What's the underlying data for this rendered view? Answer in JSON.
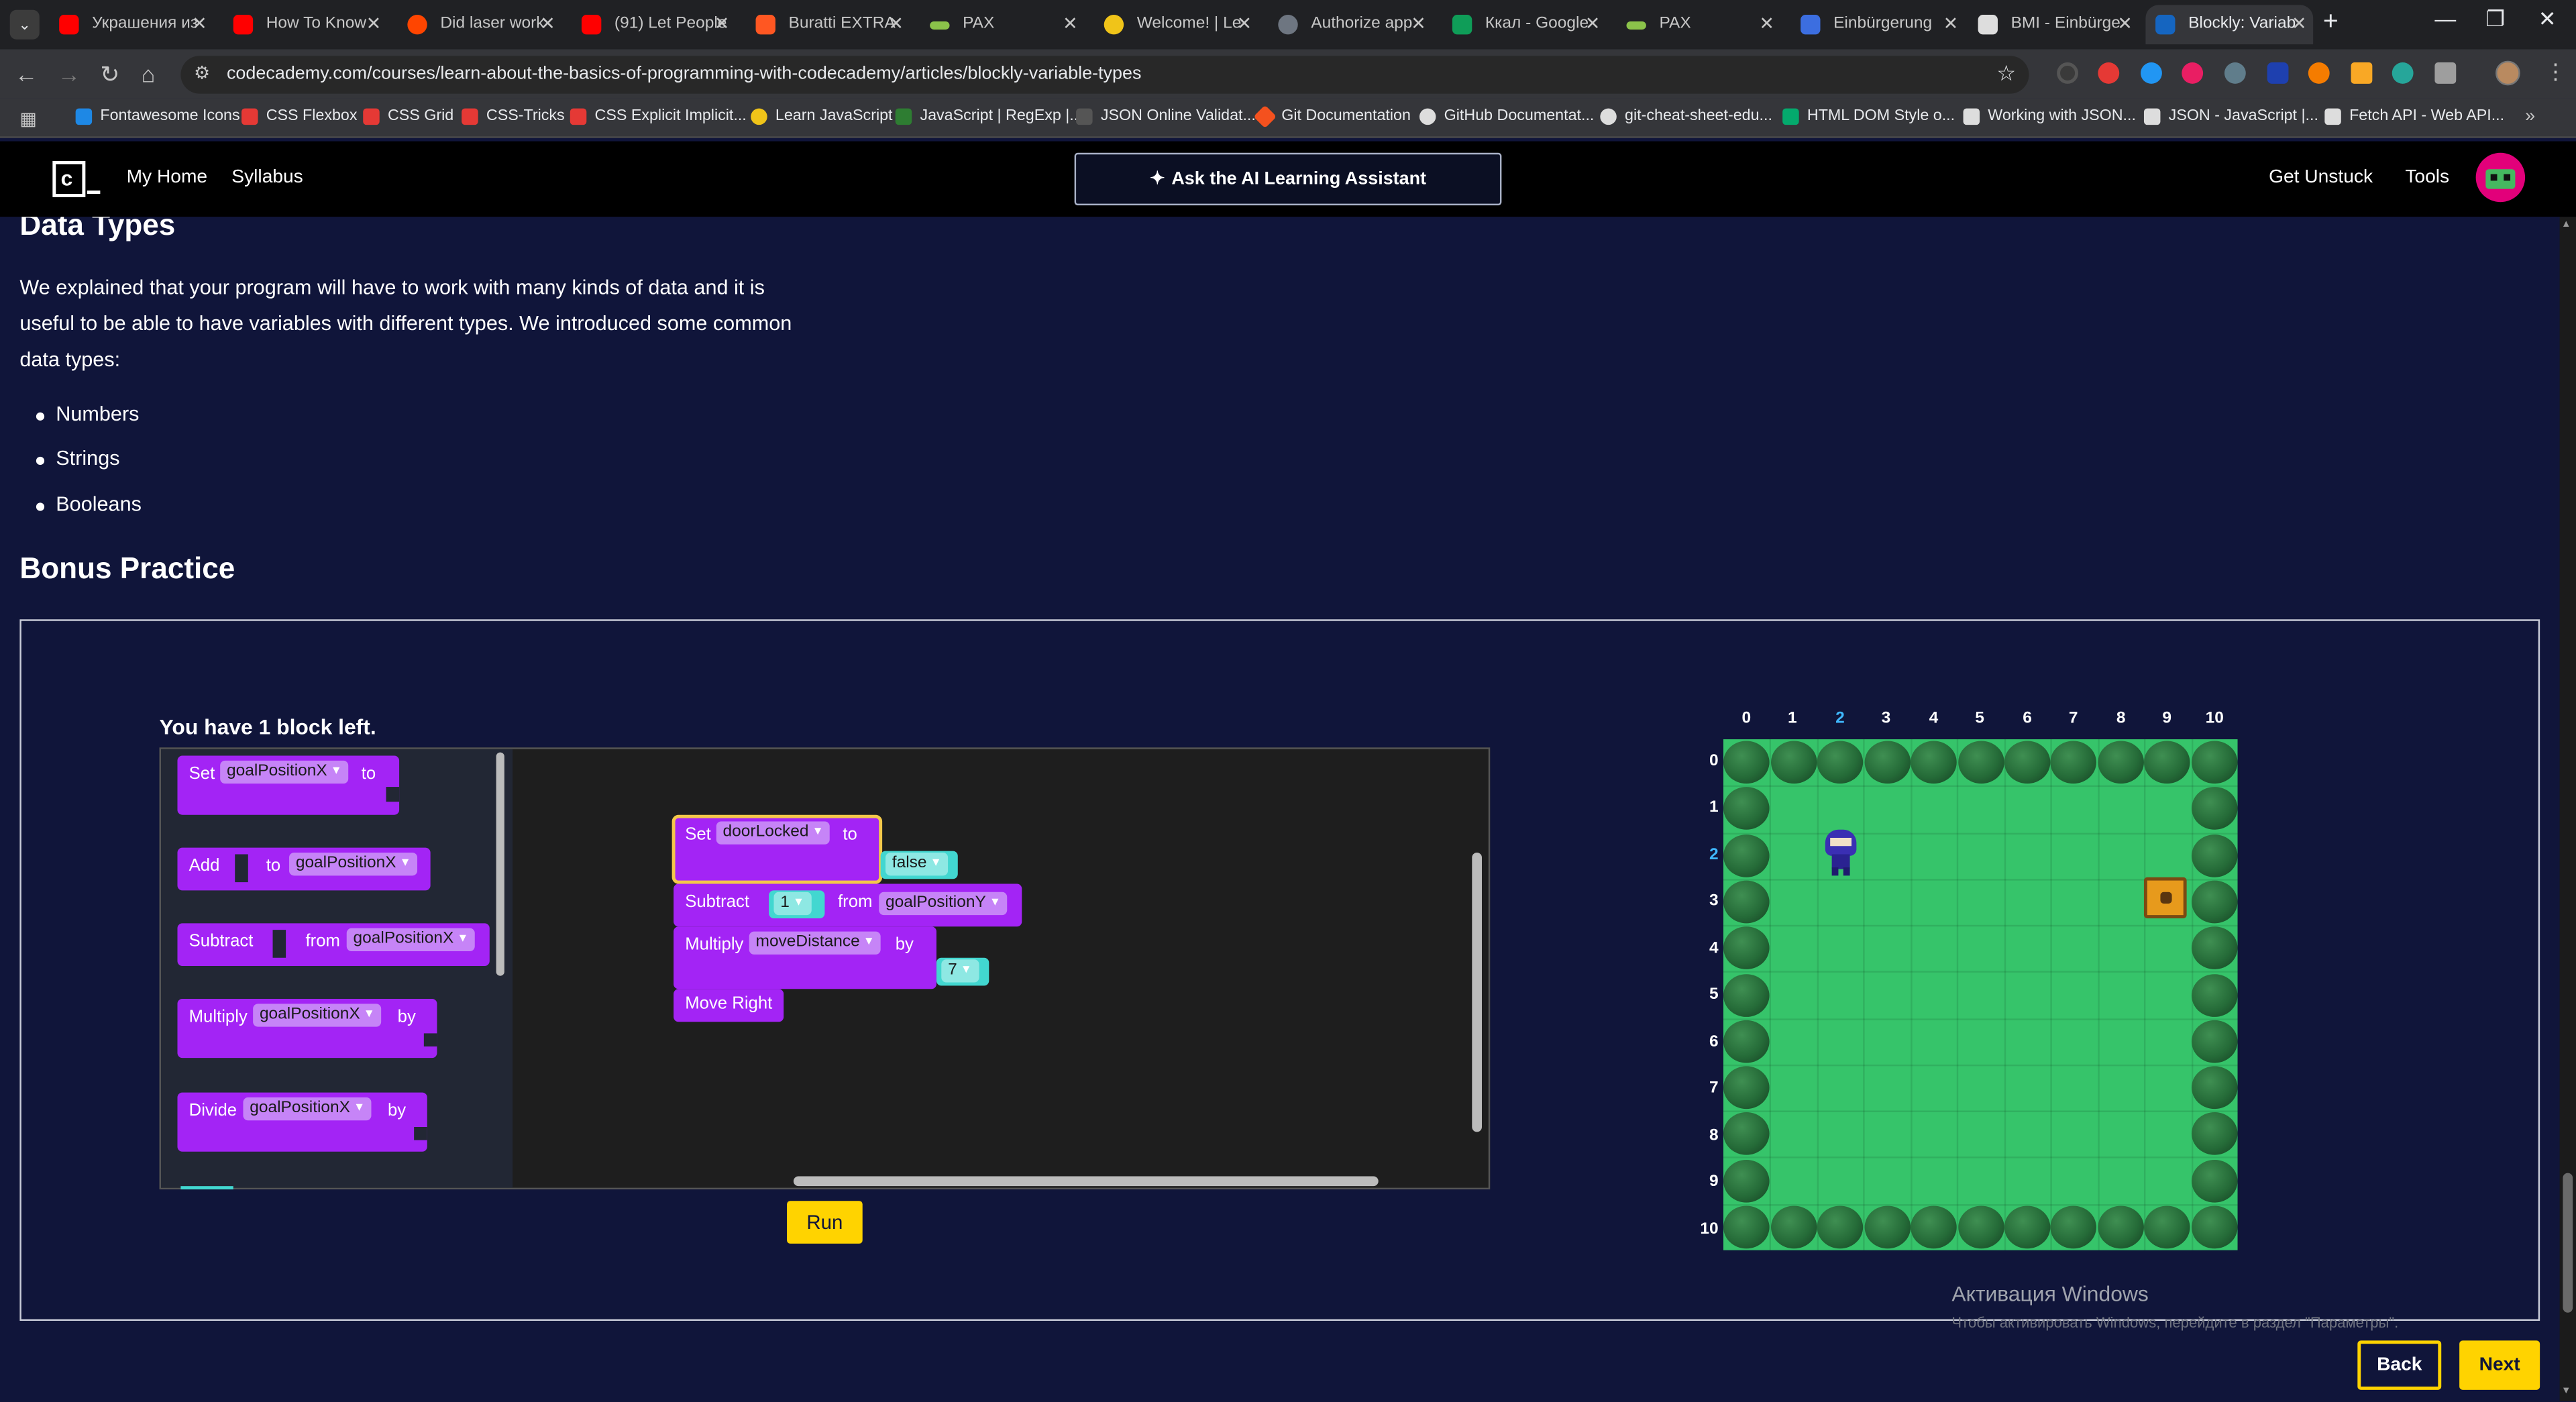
{
  "browser": {
    "tabs": [
      {
        "title": "Украшения из",
        "color": "#ff0000"
      },
      {
        "title": "How To Know",
        "color": "#ff0000"
      },
      {
        "title": "Did laser work",
        "color": "#ff4500"
      },
      {
        "title": "(91) Let People",
        "color": "#ff0000"
      },
      {
        "title": "Buratti EXTRA",
        "color": "#ff5722"
      },
      {
        "title": "PAX",
        "color": "#8bc34a"
      },
      {
        "title": "Welcome! | Le",
        "color": "#f0c419"
      },
      {
        "title": "Authorize app",
        "color": "#6e7681"
      },
      {
        "title": "Ккал - Google",
        "color": "#0f9d58"
      },
      {
        "title": "PAX",
        "color": "#8bc34a"
      },
      {
        "title": "Einbürgerung",
        "color": "#3c6ee0"
      },
      {
        "title": "BMI - Einbürge",
        "color": "#dddddd"
      },
      {
        "title": "Blockly: Variab",
        "color": "#1565c0"
      }
    ],
    "url": "codecademy.com/courses/learn-about-the-basics-of-programming-with-codecademy/articles/blockly-variable-types",
    "bookmarks": [
      {
        "label": "Fontawesome Icons",
        "color": "#1e88e5"
      },
      {
        "label": "CSS Flexbox",
        "color": "#e53935"
      },
      {
        "label": "CSS Grid",
        "color": "#e53935"
      },
      {
        "label": "CSS-Tricks",
        "color": "#e53935"
      },
      {
        "label": "CSS Explicit Implicit...",
        "color": "#e53935"
      },
      {
        "label": "Learn JavaScript",
        "color": "#f0c419"
      },
      {
        "label": "JavaScript | RegExp |...",
        "color": "#2e7d32"
      },
      {
        "label": "JSON Online Validat...",
        "color": "#555555"
      },
      {
        "label": "Git Documentation",
        "color": "#f4511e"
      },
      {
        "label": "GitHub Documentat...",
        "color": "#dddddd"
      },
      {
        "label": "git-cheat-sheet-edu...",
        "color": "#dddddd"
      },
      {
        "label": "HTML DOM Style o...",
        "color": "#04aa6d"
      },
      {
        "label": "Working with JSON...",
        "color": "#dddddd"
      },
      {
        "label": "JSON - JavaScript |...",
        "color": "#dddddd"
      },
      {
        "label": "Fetch API - Web API...",
        "color": "#dddddd"
      }
    ]
  },
  "header": {
    "logo_char": "c",
    "nav": [
      "My Home",
      "Syllabus"
    ],
    "ask_button": "Ask the AI Learning Assistant",
    "get_unstuck": "Get Unstuck",
    "tools": "Tools"
  },
  "article": {
    "data_types_heading": "Data Types",
    "paragraph": "We explained that your program will have to work with many kinds of data and it is useful to be able to have variables with different types. We introduced some common data types:",
    "bullets": [
      "Numbers",
      "Strings",
      "Booleans"
    ],
    "bonus_heading": "Bonus Practice"
  },
  "exercise": {
    "blocks_left": "You have 1 block left.",
    "flyout": {
      "set": {
        "label": "Set",
        "var": "goalPositionX",
        "suffix": "to"
      },
      "add": {
        "label": "Add",
        "mid": "to",
        "var": "goalPositionX"
      },
      "subtract": {
        "label": "Subtract",
        "mid": "from",
        "var": "goalPositionX"
      },
      "multiply": {
        "label": "Multiply",
        "var": "goalPositionX",
        "suffix": "by"
      },
      "divide": {
        "label": "Divide",
        "var": "goalPositionX",
        "suffix": "by"
      }
    },
    "workspace": {
      "set": {
        "label": "Set",
        "var": "doorLocked",
        "suffix": "to",
        "value": "false"
      },
      "subtract": {
        "label": "Subtract",
        "value": "1",
        "mid": "from",
        "var": "goalPositionY"
      },
      "multiply": {
        "label": "Multiply",
        "var": "moveDistance",
        "suffix": "by",
        "value": "7"
      },
      "move": {
        "label": "Move Right"
      }
    },
    "run_button": "Run",
    "grid": {
      "columns": [
        "0",
        "1",
        "2",
        "3",
        "4",
        "5",
        "6",
        "7",
        "8",
        "9",
        "10"
      ],
      "rows": [
        "0",
        "1",
        "2",
        "3",
        "4",
        "5",
        "6",
        "7",
        "8",
        "9",
        "10"
      ],
      "highlight_color": "#3fb8ff",
      "grass_color": "#36c46a"
    }
  },
  "watermark": {
    "title": "Активация Windows",
    "subtitle": "Чтобы активировать Windows, перейдите в раздел \"Параметры\"."
  },
  "footer": {
    "back": "Back",
    "next": "Next"
  },
  "colors": {
    "block": "#a324f5",
    "value_block": "#42d7d0",
    "accent": "#ffd300",
    "page_bg": "#10153a"
  }
}
